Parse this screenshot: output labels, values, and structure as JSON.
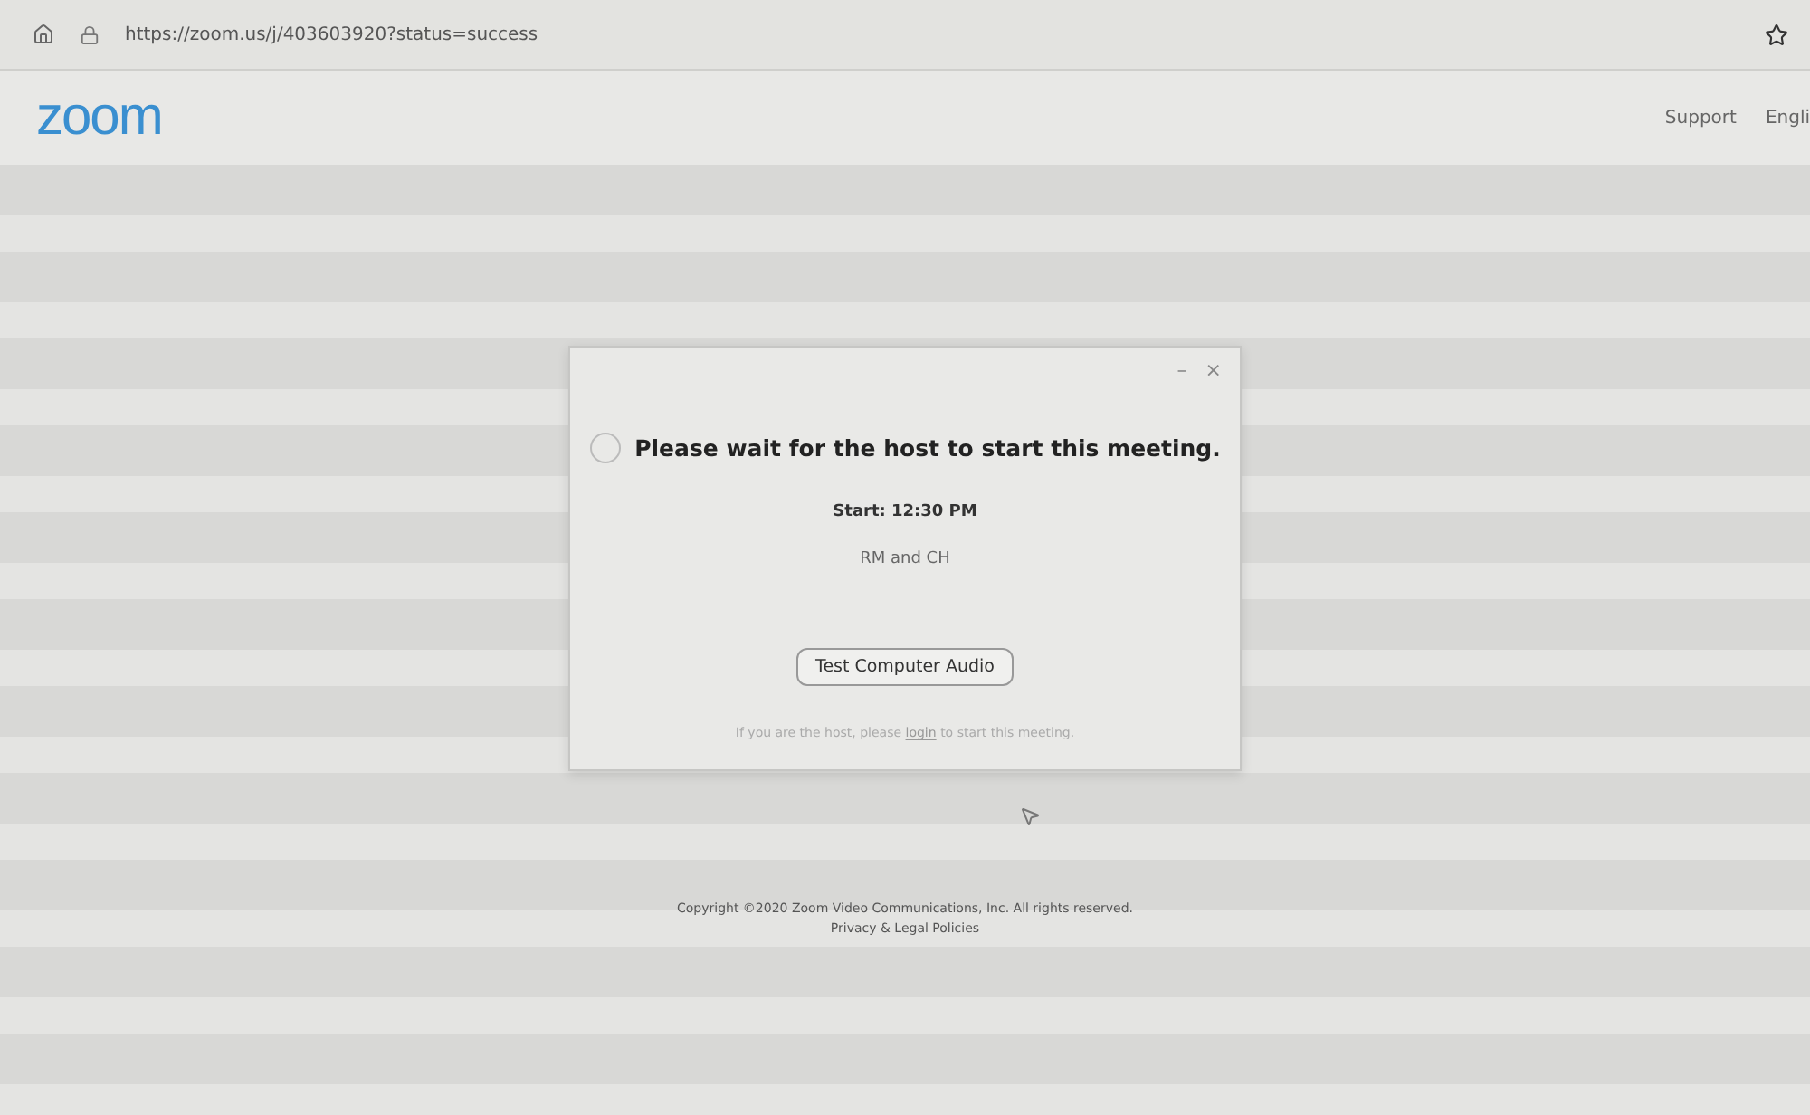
{
  "browser": {
    "url": "https://zoom.us/j/403603920?status=success"
  },
  "header": {
    "logo": "zoom",
    "links": [
      "Support",
      "Engli"
    ]
  },
  "dialog": {
    "minimize": "–",
    "close": "×",
    "title": "Please wait for the host to start this meeting.",
    "start": "Start: 12:30 PM",
    "topic": "RM and CH",
    "button": "Test Computer Audio",
    "host_note": {
      "before": "If you are the host, please",
      "link": "login",
      "after": "to start this meeting."
    }
  },
  "footer": {
    "copyright": "Copyright ©2020 Zoom Video Communications, Inc. All rights reserved.",
    "policies": "Privacy & Legal Policies"
  }
}
